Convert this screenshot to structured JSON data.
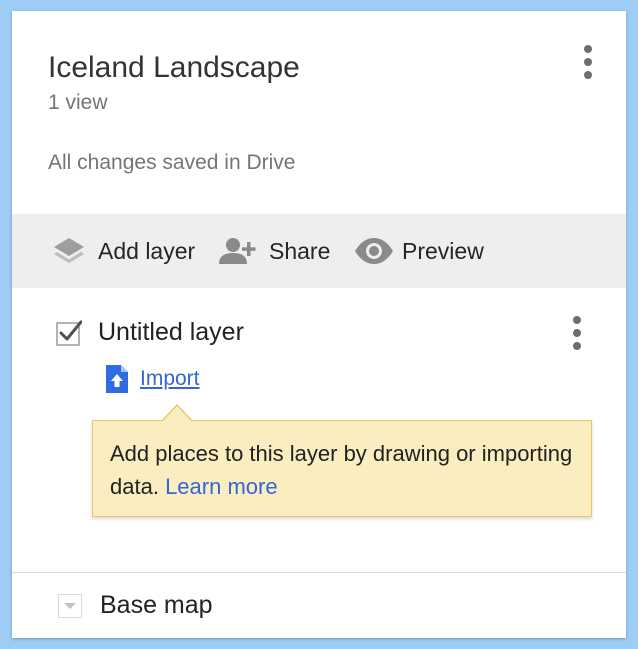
{
  "map": {
    "title": "Iceland Landscape",
    "views": "1 view",
    "save_status": "All changes saved in Drive"
  },
  "toolbar": {
    "add_layer_label": "Add layer",
    "share_label": "Share",
    "preview_label": "Preview"
  },
  "layer": {
    "name": "Untitled layer",
    "checked": true,
    "import_label": "Import",
    "tooltip_text": "Add places to this layer by drawing or importing data.",
    "tooltip_link": "Learn more"
  },
  "base_map": {
    "label": "Base map"
  },
  "icons": {
    "header_menu": "more-vert-icon",
    "add_layer": "layers-icon",
    "share": "person-add-icon",
    "preview": "eye-icon",
    "layer_menu": "more-vert-icon",
    "checkbox": "checkbox-checked-icon",
    "import": "file-upload-icon",
    "base_map_toggle": "triangle-down-icon"
  },
  "colors": {
    "background": "#9dcdf5",
    "toolbar": "#eeeeee",
    "link": "#3367d6",
    "tooltip_bg": "#faedc0",
    "tooltip_border": "#e9c56b"
  }
}
